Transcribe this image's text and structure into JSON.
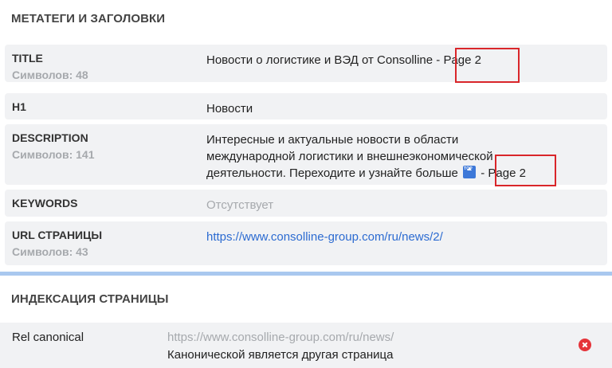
{
  "meta_section": {
    "title": "МЕТАТЕГИ И ЗАГОЛОВКИ",
    "title_row": {
      "label": "TITLE",
      "sub": "Символов: 48",
      "value_main": "Новости о логистике и ВЭД от Consolline - ",
      "value_page": "Page 2"
    },
    "h1_row": {
      "label": "H1",
      "value": "Новости"
    },
    "description_row": {
      "label": "DESCRIPTION",
      "sub": "Символов: 141",
      "line1": "Интересные и актуальные новости в области",
      "line2": "международной логистики и внешнеэкономической",
      "line3": "деятельности. Переходите и узнайте больше",
      "line3_page": " - Page 2",
      "icon": "top-icon"
    },
    "keywords_row": {
      "label": "KEYWORDS",
      "value": "Отсутствует"
    },
    "url_row": {
      "label": "URL СТРАНИЦЫ",
      "sub": "Символов: 43",
      "value": "https://www.consolline-group.com/ru/news/2/"
    }
  },
  "indexing_section": {
    "title": "ИНДЕКСАЦИЯ СТРАНИЦЫ",
    "canonical_row": {
      "label": "Rel canonical",
      "url": "https://www.consolline-group.com/ru/news/",
      "note": "Канонической является другая страница",
      "status_icon": "error-icon"
    }
  },
  "colors": {
    "row_bg": "#f1f2f4",
    "highlight": "#d9262a",
    "link": "#2c6bd1",
    "divider": "#a9c8ef",
    "error": "#e5343a"
  }
}
